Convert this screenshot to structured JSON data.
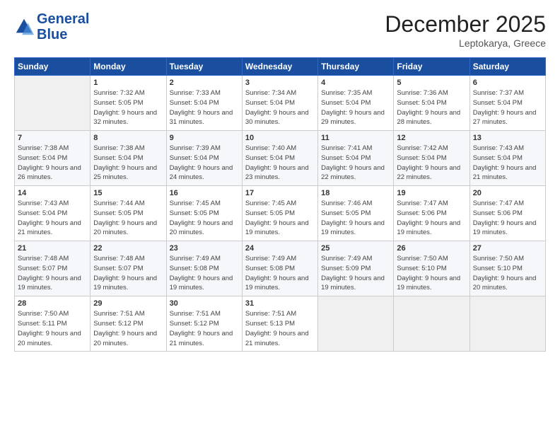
{
  "header": {
    "logo_line1": "General",
    "logo_line2": "Blue",
    "month": "December 2025",
    "location": "Leptokarya, Greece"
  },
  "days_of_week": [
    "Sunday",
    "Monday",
    "Tuesday",
    "Wednesday",
    "Thursday",
    "Friday",
    "Saturday"
  ],
  "weeks": [
    [
      {
        "day": "",
        "empty": true
      },
      {
        "day": "1",
        "sunrise": "7:32 AM",
        "sunset": "5:05 PM",
        "daylight": "9 hours and 32 minutes."
      },
      {
        "day": "2",
        "sunrise": "7:33 AM",
        "sunset": "5:04 PM",
        "daylight": "9 hours and 31 minutes."
      },
      {
        "day": "3",
        "sunrise": "7:34 AM",
        "sunset": "5:04 PM",
        "daylight": "9 hours and 30 minutes."
      },
      {
        "day": "4",
        "sunrise": "7:35 AM",
        "sunset": "5:04 PM",
        "daylight": "9 hours and 29 minutes."
      },
      {
        "day": "5",
        "sunrise": "7:36 AM",
        "sunset": "5:04 PM",
        "daylight": "9 hours and 28 minutes."
      },
      {
        "day": "6",
        "sunrise": "7:37 AM",
        "sunset": "5:04 PM",
        "daylight": "9 hours and 27 minutes."
      }
    ],
    [
      {
        "day": "7",
        "sunrise": "7:38 AM",
        "sunset": "5:04 PM",
        "daylight": "9 hours and 26 minutes."
      },
      {
        "day": "8",
        "sunrise": "7:38 AM",
        "sunset": "5:04 PM",
        "daylight": "9 hours and 25 minutes."
      },
      {
        "day": "9",
        "sunrise": "7:39 AM",
        "sunset": "5:04 PM",
        "daylight": "9 hours and 24 minutes."
      },
      {
        "day": "10",
        "sunrise": "7:40 AM",
        "sunset": "5:04 PM",
        "daylight": "9 hours and 23 minutes."
      },
      {
        "day": "11",
        "sunrise": "7:41 AM",
        "sunset": "5:04 PM",
        "daylight": "9 hours and 22 minutes."
      },
      {
        "day": "12",
        "sunrise": "7:42 AM",
        "sunset": "5:04 PM",
        "daylight": "9 hours and 22 minutes."
      },
      {
        "day": "13",
        "sunrise": "7:43 AM",
        "sunset": "5:04 PM",
        "daylight": "9 hours and 21 minutes."
      }
    ],
    [
      {
        "day": "14",
        "sunrise": "7:43 AM",
        "sunset": "5:04 PM",
        "daylight": "9 hours and 21 minutes."
      },
      {
        "day": "15",
        "sunrise": "7:44 AM",
        "sunset": "5:05 PM",
        "daylight": "9 hours and 20 minutes."
      },
      {
        "day": "16",
        "sunrise": "7:45 AM",
        "sunset": "5:05 PM",
        "daylight": "9 hours and 20 minutes."
      },
      {
        "day": "17",
        "sunrise": "7:45 AM",
        "sunset": "5:05 PM",
        "daylight": "9 hours and 19 minutes."
      },
      {
        "day": "18",
        "sunrise": "7:46 AM",
        "sunset": "5:05 PM",
        "daylight": "9 hours and 19 minutes."
      },
      {
        "day": "19",
        "sunrise": "7:47 AM",
        "sunset": "5:06 PM",
        "daylight": "9 hours and 19 minutes."
      },
      {
        "day": "20",
        "sunrise": "7:47 AM",
        "sunset": "5:06 PM",
        "daylight": "9 hours and 19 minutes."
      }
    ],
    [
      {
        "day": "21",
        "sunrise": "7:48 AM",
        "sunset": "5:07 PM",
        "daylight": "9 hours and 19 minutes."
      },
      {
        "day": "22",
        "sunrise": "7:48 AM",
        "sunset": "5:07 PM",
        "daylight": "9 hours and 19 minutes."
      },
      {
        "day": "23",
        "sunrise": "7:49 AM",
        "sunset": "5:08 PM",
        "daylight": "9 hours and 19 minutes."
      },
      {
        "day": "24",
        "sunrise": "7:49 AM",
        "sunset": "5:08 PM",
        "daylight": "9 hours and 19 minutes."
      },
      {
        "day": "25",
        "sunrise": "7:49 AM",
        "sunset": "5:09 PM",
        "daylight": "9 hours and 19 minutes."
      },
      {
        "day": "26",
        "sunrise": "7:50 AM",
        "sunset": "5:10 PM",
        "daylight": "9 hours and 19 minutes."
      },
      {
        "day": "27",
        "sunrise": "7:50 AM",
        "sunset": "5:10 PM",
        "daylight": "9 hours and 20 minutes."
      }
    ],
    [
      {
        "day": "28",
        "sunrise": "7:50 AM",
        "sunset": "5:11 PM",
        "daylight": "9 hours and 20 minutes."
      },
      {
        "day": "29",
        "sunrise": "7:51 AM",
        "sunset": "5:12 PM",
        "daylight": "9 hours and 20 minutes."
      },
      {
        "day": "30",
        "sunrise": "7:51 AM",
        "sunset": "5:12 PM",
        "daylight": "9 hours and 21 minutes."
      },
      {
        "day": "31",
        "sunrise": "7:51 AM",
        "sunset": "5:13 PM",
        "daylight": "9 hours and 21 minutes."
      },
      {
        "day": "",
        "empty": true
      },
      {
        "day": "",
        "empty": true
      },
      {
        "day": "",
        "empty": true
      }
    ]
  ]
}
